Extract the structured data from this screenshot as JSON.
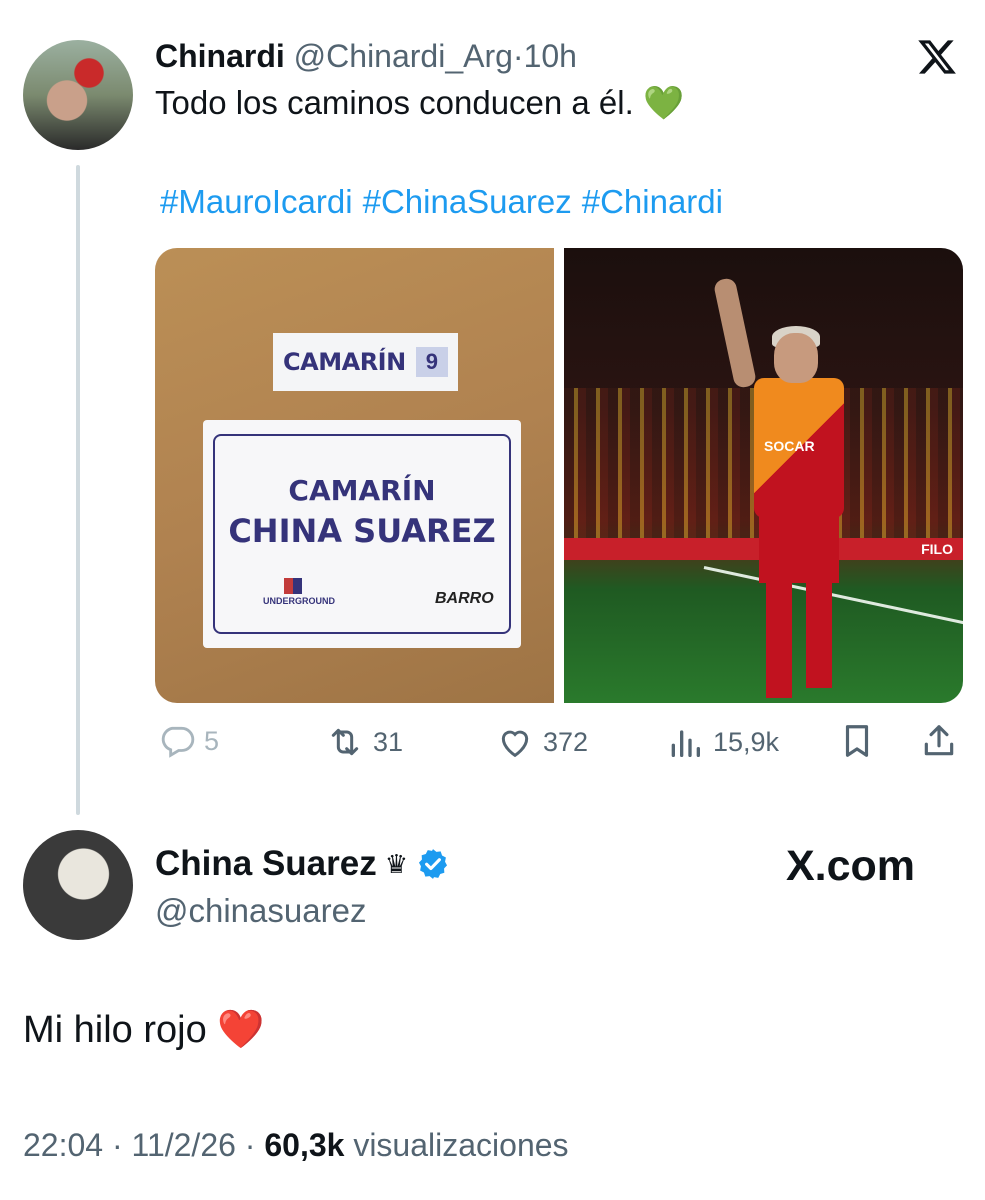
{
  "quoted_tweet": {
    "display_name": "Chinardi",
    "handle": "@Chinardi_Arg",
    "separator": "·",
    "time": "10h",
    "text": "Todo los caminos conducen a él.",
    "emoji": "💚",
    "hashtags": [
      "#MauroIcardi",
      "#ChinaSuarez",
      "#Chinardi"
    ],
    "media": {
      "left_image": {
        "small_sign": "CAMARÍN",
        "small_sign_number": "9",
        "big_sign_line1": "CAMARÍN",
        "big_sign_line2": "CHINA SUAREZ",
        "logo_left": "UNDERGROUND",
        "logo_right": "BARRO"
      },
      "right_image": {
        "sponsor": "SOCAR",
        "board_text": "FILO"
      }
    },
    "actions": {
      "replies": "5",
      "retweets": "31",
      "likes": "372",
      "views": "15,9k"
    }
  },
  "main_tweet": {
    "display_name": "China Suarez",
    "crown": "♛",
    "handle": "@chinasuarez",
    "text": "Mi hilo rojo",
    "emoji": "❤️",
    "time": "22:04",
    "date": "11/2/26",
    "views_count": "60,3k",
    "views_label": "visualizaciones"
  },
  "watermark": "X.com",
  "colors": {
    "link": "#1d9bf0",
    "text": "#0f1419",
    "muted": "#536471",
    "verified": "#1d9bf0"
  }
}
